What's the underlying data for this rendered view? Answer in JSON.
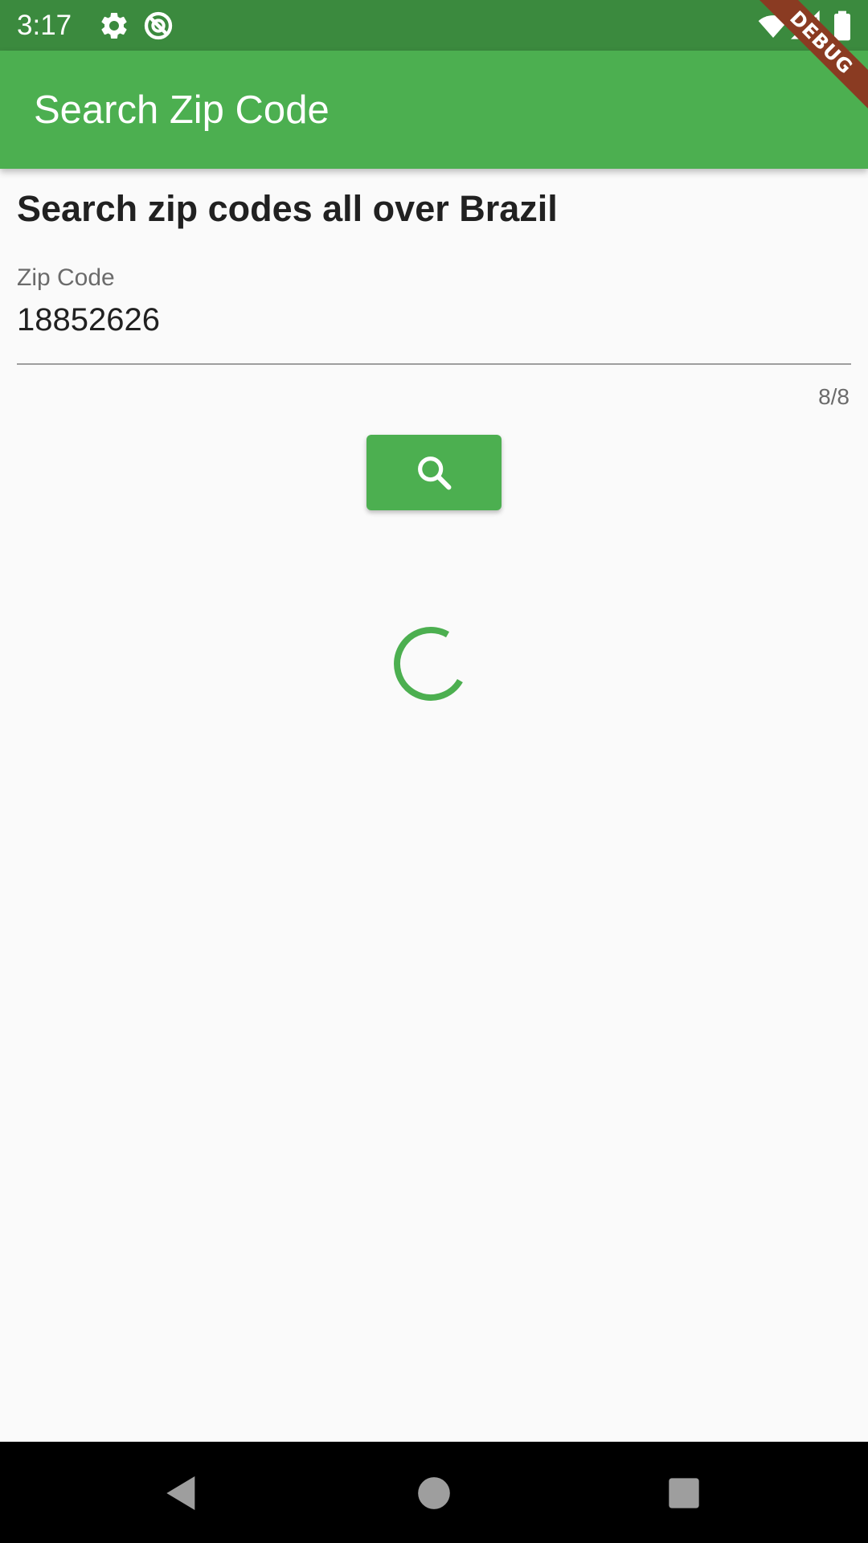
{
  "status_bar": {
    "time": "3:17",
    "icons": [
      "gear-icon",
      "data-saver-icon",
      "wifi-icon",
      "signal-icon",
      "battery-icon"
    ]
  },
  "debug_banner": {
    "label": "DEBUG"
  },
  "app_bar": {
    "title": "Search Zip Code"
  },
  "main": {
    "heading": "Search zip codes all over Brazil",
    "zip_field": {
      "label": "Zip Code",
      "value": "18852626",
      "counter": "8/8"
    },
    "search_button": {
      "icon": "search-icon"
    },
    "loading": {
      "icon": "progress-spinner"
    }
  },
  "nav_bar": {
    "buttons": [
      "back-icon",
      "home-icon",
      "recents-icon"
    ]
  },
  "colors": {
    "primary": "#4caf50",
    "status_bar": "#3b8a3e",
    "background": "#fafafa",
    "debug_ribbon": "#8a3b22"
  }
}
